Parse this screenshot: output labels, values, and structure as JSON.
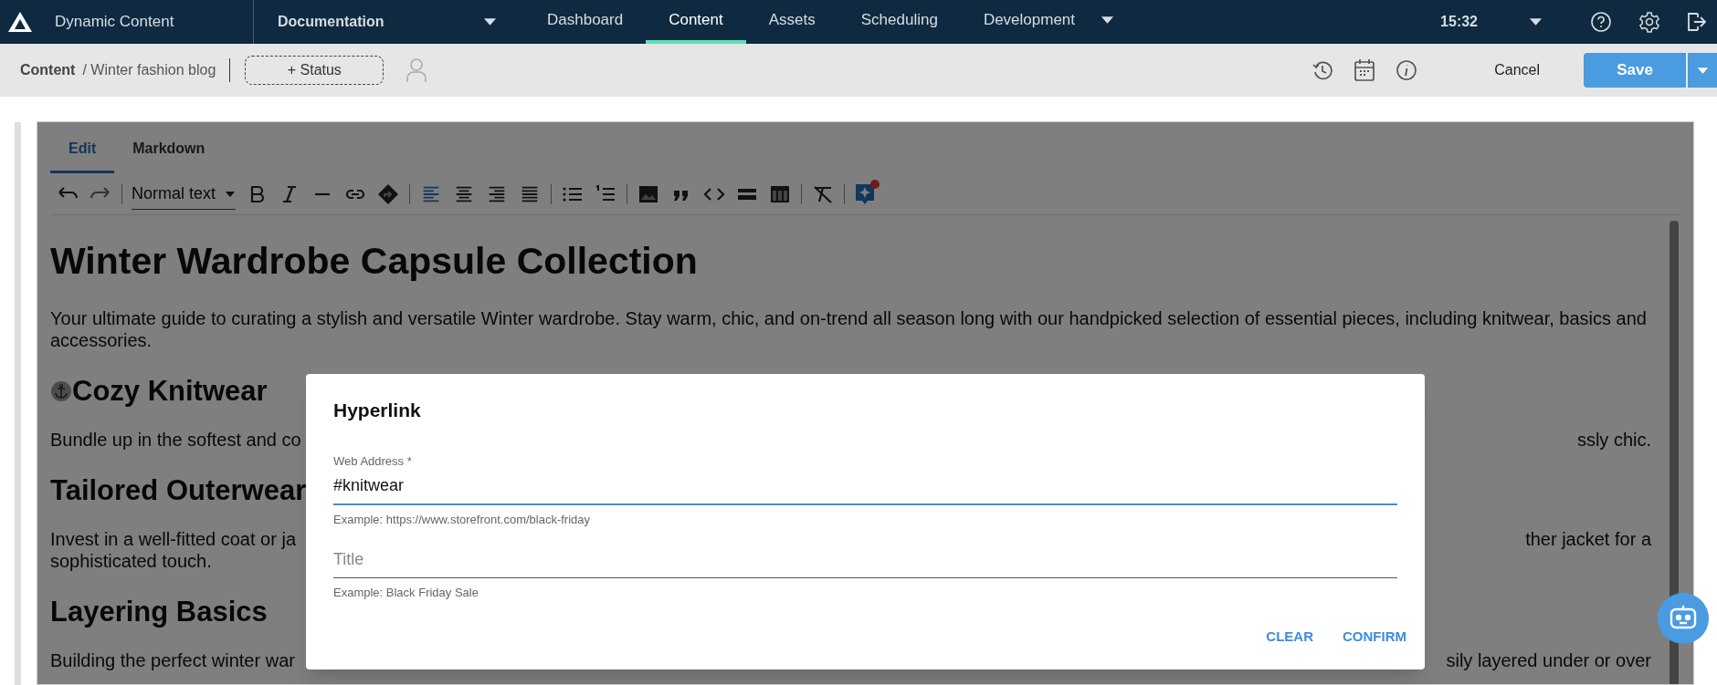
{
  "app": {
    "title": "Dynamic Content",
    "hub": "Documentation"
  },
  "nav": [
    {
      "label": "Dashboard",
      "selected": false,
      "dropdown": false
    },
    {
      "label": "Content",
      "selected": true,
      "dropdown": false
    },
    {
      "label": "Assets",
      "selected": false,
      "dropdown": false
    },
    {
      "label": "Scheduling",
      "selected": false,
      "dropdown": false
    },
    {
      "label": "Development",
      "selected": false,
      "dropdown": true
    }
  ],
  "clock": "15:32",
  "breadcrumb": {
    "root": "Content",
    "item": "/ Winter fashion blog"
  },
  "status_button": "+ Status",
  "actions": {
    "cancel": "Cancel",
    "save": "Save"
  },
  "editor_tabs": [
    {
      "label": "Edit",
      "selected": true
    },
    {
      "label": "Markdown",
      "selected": false
    }
  ],
  "toolbar": {
    "block_style": "Normal text",
    "alignments": [
      {
        "selected": true
      },
      {
        "selected": false
      },
      {
        "selected": false
      },
      {
        "selected": false
      }
    ],
    "notification": true
  },
  "document": [
    {
      "kind": "h1",
      "text": "Winter Wardrobe Capsule Collection"
    },
    {
      "kind": "p",
      "text": "Your ultimate guide to curating a stylish and versatile Winter wardrobe. Stay warm, chic, and on-trend all season long with our handpicked selection of essential pieces, including knitwear, basics and accessories."
    },
    {
      "kind": "h2",
      "text": "Cozy Knitwear",
      "anchor": true
    },
    {
      "kind": "p",
      "text": "Bundle up in the softest and co",
      "end": "ssly chic."
    },
    {
      "kind": "h2",
      "text": "Tailored Outerwear",
      "anchor": false
    },
    {
      "kind": "p2",
      "text": "Invest in a well-fitted coat or ja",
      "end": "ther jacket for a",
      "next": "sophisticated touch."
    },
    {
      "kind": "h2",
      "text": "Layering Basics",
      "anchor": false
    },
    {
      "kind": "p",
      "text": "Building the perfect winter war",
      "end": "sily layered under or over"
    }
  ],
  "dialog": {
    "title": "Hyperlink",
    "fields": [
      {
        "label": "Web Address *",
        "value": "#knitwear",
        "focused": true,
        "hint": "Example: https://www.storefront.com/black-friday"
      },
      {
        "placeholder": "Title",
        "focused": false,
        "hint": "Example: Black Friday Sale"
      }
    ],
    "buttons": [
      "CLEAR",
      "CONFIRM"
    ]
  }
}
